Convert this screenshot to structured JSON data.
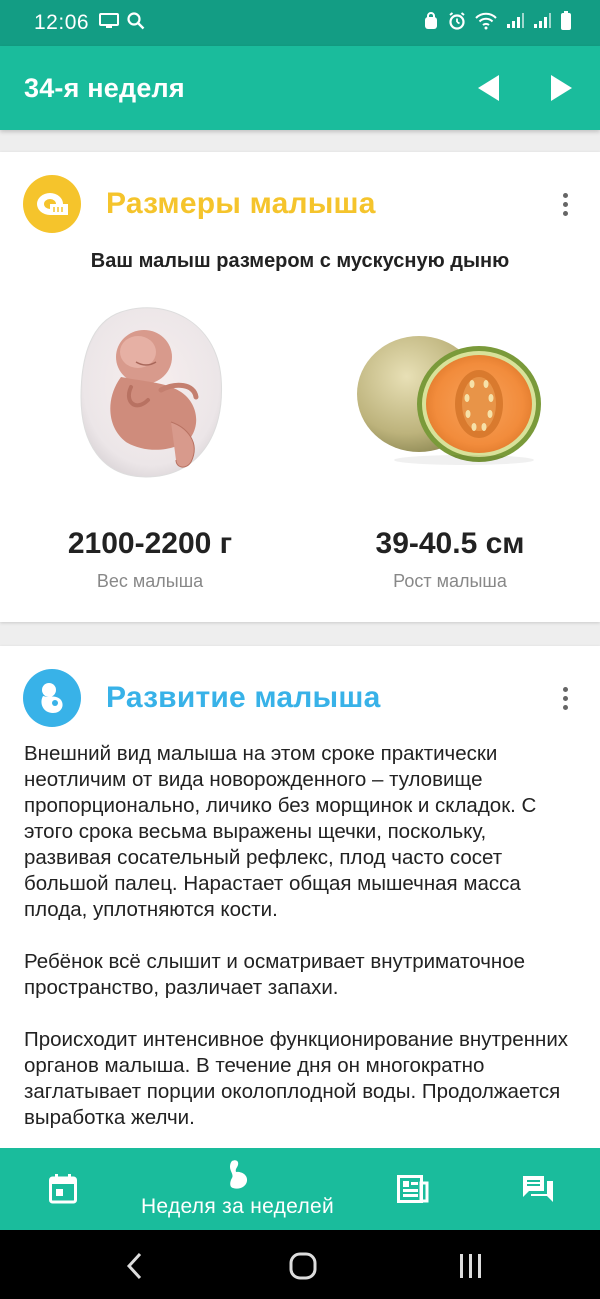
{
  "status_bar": {
    "time": "12:06"
  },
  "header": {
    "title": "34-я неделя"
  },
  "size_card": {
    "title": "Размеры малыша",
    "subtitle": "Ваш малыш размером с мускусную дыню",
    "weight": {
      "value": "2100-2200 г",
      "label": "Вес малыша"
    },
    "height": {
      "value": "39-40.5 см",
      "label": "Рост малыша"
    },
    "accent_color": "#f5c42c"
  },
  "dev_card": {
    "title": "Развитие малыша",
    "accent_color": "#38b2e8",
    "paragraphs": [
      "Внешний вид малыша на этом сроке практически неотличим от вида новорожденного – туловище пропорционально, личико без морщинок и складок. С этого срока весьма выражены щечки, поскольку, развивая сосательный рефлекс, плод часто сосет большой палец. Нарастает общая мышечная масса плода, уплотняются кости.",
      "Ребёнок всё слышит и осматривает внутриматочное пространство, различает запахи.",
      "Происходит интенсивное функционирование внутренних органов малыша. В течение дня он многократно заглатывает порции околоплодной воды. Продолжается выработка желчи."
    ]
  },
  "bottom_nav": {
    "active_label": "Неделя за неделей"
  },
  "colors": {
    "primary": "#1abc9c",
    "status_bar": "#139d84"
  }
}
